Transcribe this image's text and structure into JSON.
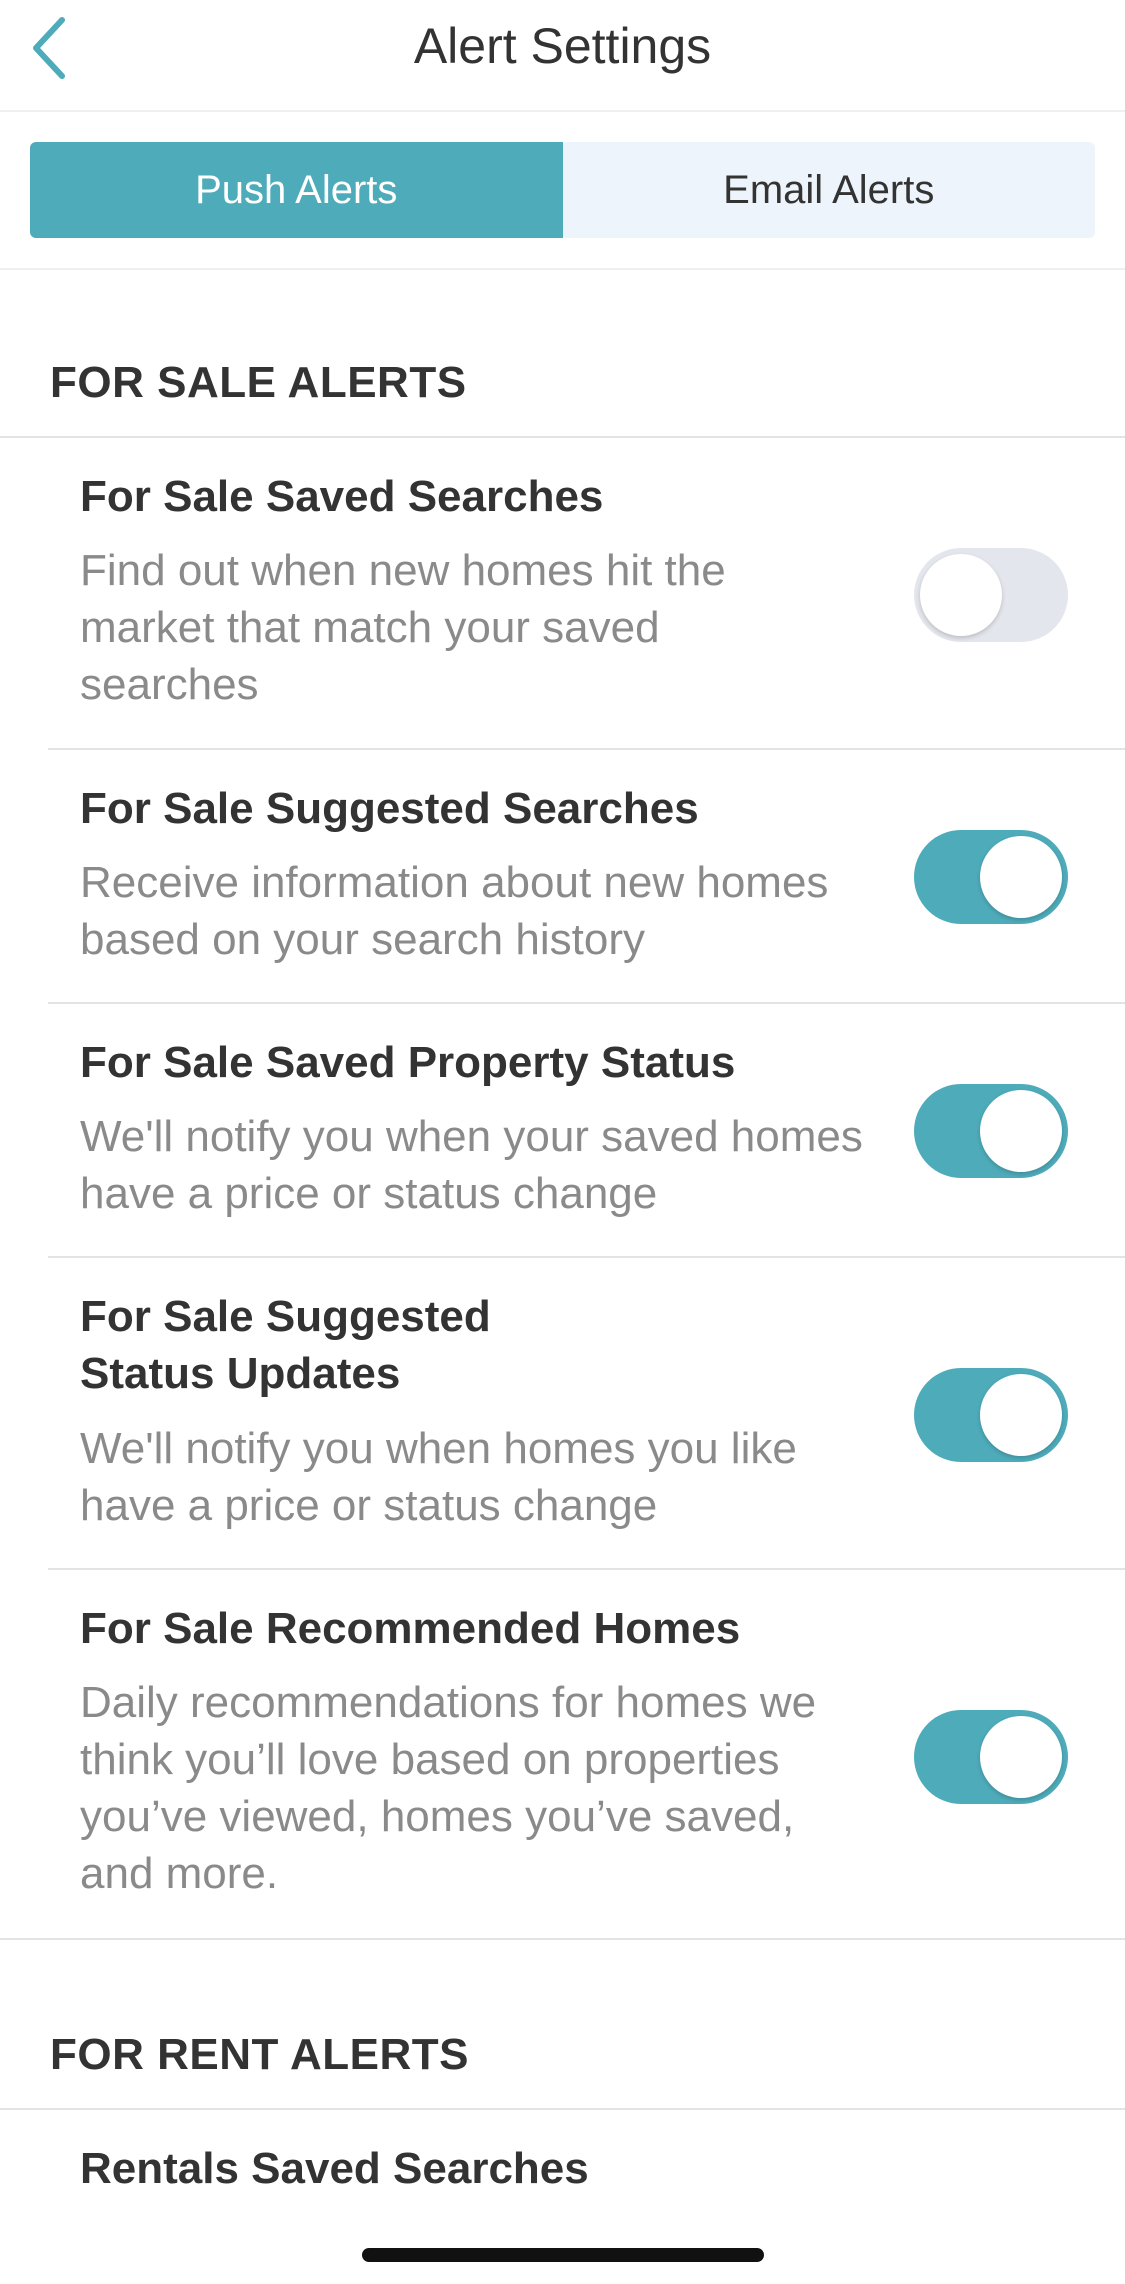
{
  "header": {
    "title": "Alert Settings"
  },
  "tabs": [
    {
      "label": "Push Alerts",
      "active": true
    },
    {
      "label": "Email Alerts",
      "active": false
    }
  ],
  "sections": {
    "for_sale": {
      "title": "FOR SALE ALERTS",
      "items": [
        {
          "title": "For Sale Saved Searches",
          "description": "Find out when new homes hit the market that match your saved searches",
          "enabled": false
        },
        {
          "title": "For Sale Suggested Searches",
          "description": "Receive information about new homes based on your search history",
          "enabled": true
        },
        {
          "title": "For Sale Saved Property Status",
          "description": "We'll notify you when your saved homes have a price or status change",
          "enabled": true
        },
        {
          "title": "For Sale Suggested Status Updates",
          "description": "We'll notify you when homes you like have a price or status change",
          "enabled": true
        },
        {
          "title": "For Sale Recommended Homes",
          "description": "Daily recommendations for homes we think you’ll love based on properties you’ve viewed, homes you’ve saved, and more.",
          "enabled": true
        }
      ]
    },
    "for_rent": {
      "title": "FOR RENT ALERTS",
      "items": [
        {
          "title": "Rentals Saved Searches"
        }
      ]
    }
  },
  "colors": {
    "accent": "#4eabba",
    "toggle_off": "#e3e6ec",
    "segment_bg": "#eef4fb",
    "description_text": "#8a8a8a"
  },
  "icons": {
    "back": "chevron-left-icon"
  }
}
